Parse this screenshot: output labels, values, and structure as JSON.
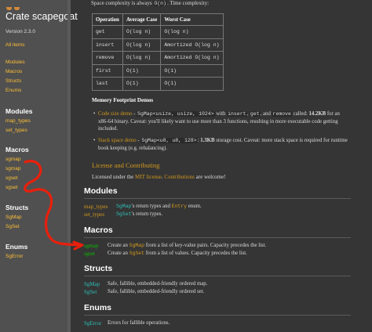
{
  "sidebar": {
    "title": "Crate scapegoat",
    "version": "Version 2.3.0",
    "all_items": "All items",
    "top_links": [
      "Modules",
      "Macros",
      "Structs",
      "Enums"
    ],
    "modules_heading": "Modules",
    "modules": [
      "map_types",
      "set_types"
    ],
    "macros_heading": "Macros",
    "macros": [
      "sgmap",
      "sgmap",
      "sgset",
      "sgset"
    ],
    "structs_heading": "Structs",
    "structs": [
      "SgMap",
      "SgSet"
    ],
    "enums_heading": "Enums",
    "enums": [
      "SgError"
    ]
  },
  "main": {
    "space_line_pre": "Space complexity is always ",
    "space_line_code": "O(n)",
    "space_line_post": ". Time complexity:",
    "table": {
      "headers": [
        "Operation",
        "Average Case",
        "Worst Case"
      ],
      "rows": [
        [
          "get",
          "O(log n)",
          "O(log n)"
        ],
        [
          "insert",
          "O(log n)",
          "Amortized O(log n)"
        ],
        [
          "remove",
          "O(log n)",
          "Amortized O(log n)"
        ],
        [
          "first",
          "O(1)",
          "O(1)"
        ],
        [
          "last",
          "O(1)",
          "O(1)"
        ]
      ]
    },
    "memory_heading": "Memory Footprint Demos",
    "bullet1": {
      "link": "Code size demo",
      "dash": " - ",
      "code1": "SgMap<usize, usize, 1024>",
      "t1": " with ",
      "code2": "insert",
      "t2": ", ",
      "code3": "get",
      "t3": ", and ",
      "code4": "remove",
      "t4": " called: ",
      "bold": "14.2KB",
      "t5": " for an",
      "line2": "x86-64 binary. Caveat: you'll likely want to use more than 3 functions, resulting in more executable code getting",
      "line3": "included."
    },
    "bullet2": {
      "link": "Stack space demo",
      "dash": " - ",
      "code": "SgMap<u8, u8, 128>",
      "t1": ": ",
      "bold": "1.3KB",
      "t2": " storage cost. Caveat: more stack space is required for runtime",
      "line2": "book keeping (e.g. rebalancing)."
    },
    "license_heading": "License and Contributing",
    "license_pre": "Licensed under the ",
    "license_link": "MIT license",
    "license_mid": ". ",
    "contrib_link": "Contributions",
    "license_post": " are welcome!",
    "modules_heading": "Modules",
    "modules": [
      {
        "name": "map_types",
        "pre": "",
        "type": "SgMap",
        "post": "'s return types and ",
        "type2": "Entry",
        "post2": " enum."
      },
      {
        "name": "set_types",
        "pre": "",
        "type": "SgSet",
        "post": "'s return types.",
        "type2": "",
        "post2": ""
      }
    ],
    "macros_heading": "Macros",
    "macros": [
      {
        "name": "sgmap",
        "pre": "Create an ",
        "type": "SgMap",
        "post": " from a list of key-value pairs. Capacity precedes the list."
      },
      {
        "name": "sgset",
        "pre": "Create an ",
        "type": "SgSet",
        "post": " from a list of values. Capacity precedes the list."
      }
    ],
    "structs_heading": "Structs",
    "structs": [
      {
        "name": "SgMap",
        "desc": "Safe, fallible, embedded-friendly ordered map."
      },
      {
        "name": "SgSet",
        "desc": "Safe, fallible, embedded-friendly ordered set."
      }
    ],
    "enums_heading": "Enums",
    "enums": [
      {
        "name": "SgError",
        "desc": "Errors for fallible operations."
      }
    ]
  },
  "colors": {
    "annotation": "#e8200c",
    "link": "#d2991d",
    "macro": "#09bd00",
    "type": "#2dbfb8"
  }
}
